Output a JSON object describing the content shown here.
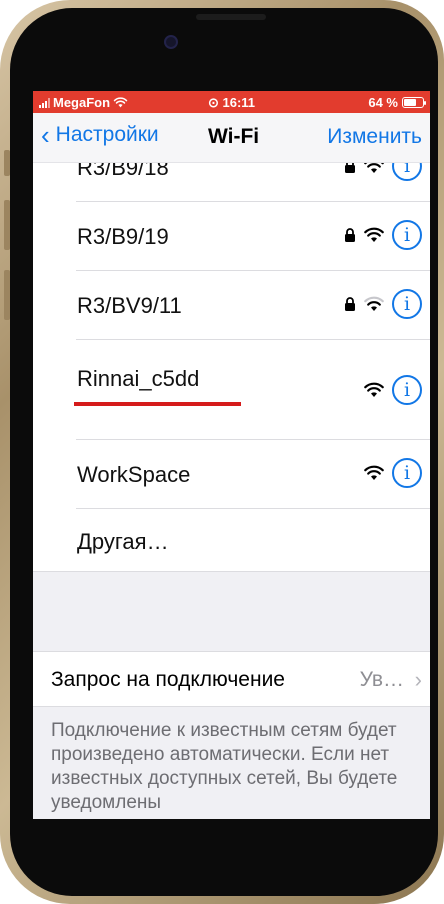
{
  "status_bar": {
    "carrier": "MegaFon",
    "time": "16:11",
    "battery": "64 %",
    "battery_level": 0.64
  },
  "navbar": {
    "back_label": "Настройки",
    "title": "Wi-Fi",
    "edit_label": "Изменить"
  },
  "networks": [
    {
      "name": "R3/B9/18",
      "secured": true,
      "signal": "full"
    },
    {
      "name": "R3/B9/19",
      "secured": true,
      "signal": "full"
    },
    {
      "name": "R3/BV9/11",
      "secured": true,
      "signal": "weak"
    },
    {
      "name": "Rinnai_c5dd",
      "secured": false,
      "signal": "full",
      "highlighted": true
    },
    {
      "name": "WorkSpace",
      "secured": false,
      "signal": "full"
    }
  ],
  "other_label": "Другая…",
  "ask_to_join": {
    "label": "Запрос на подключение",
    "value": "Ув…"
  },
  "footer_text": "Подключение к известным сетям будет произведено автоматически. Если нет известных доступных сетей, Вы будете уведомлены",
  "colors": {
    "accent": "#1277e6",
    "status_bar": "#e23c2e",
    "highlight_underline": "#d51b1b"
  }
}
